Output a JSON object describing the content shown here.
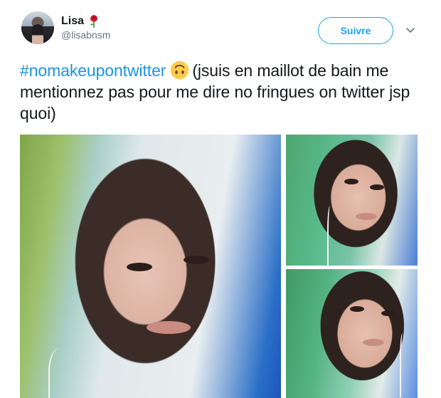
{
  "user": {
    "display_name": "Lisa",
    "handle": "@lisabnsm",
    "name_emoji": "rose-icon"
  },
  "actions": {
    "follow_label": "Suivre",
    "menu_icon": "chevron-down-icon"
  },
  "tweet": {
    "hashtag": "#nomakeupontwitter",
    "emoji": "upside-down-face-icon",
    "text": "(jsuis en maillot de bain me mentionnez pas pour me dire no fringues on twitter jsp quoi)"
  },
  "media": {
    "photo_count": 3
  },
  "colors": {
    "accent": "#1da1f2",
    "hashtag": "#1b95e0",
    "text": "#14171a",
    "muted": "#657786"
  }
}
